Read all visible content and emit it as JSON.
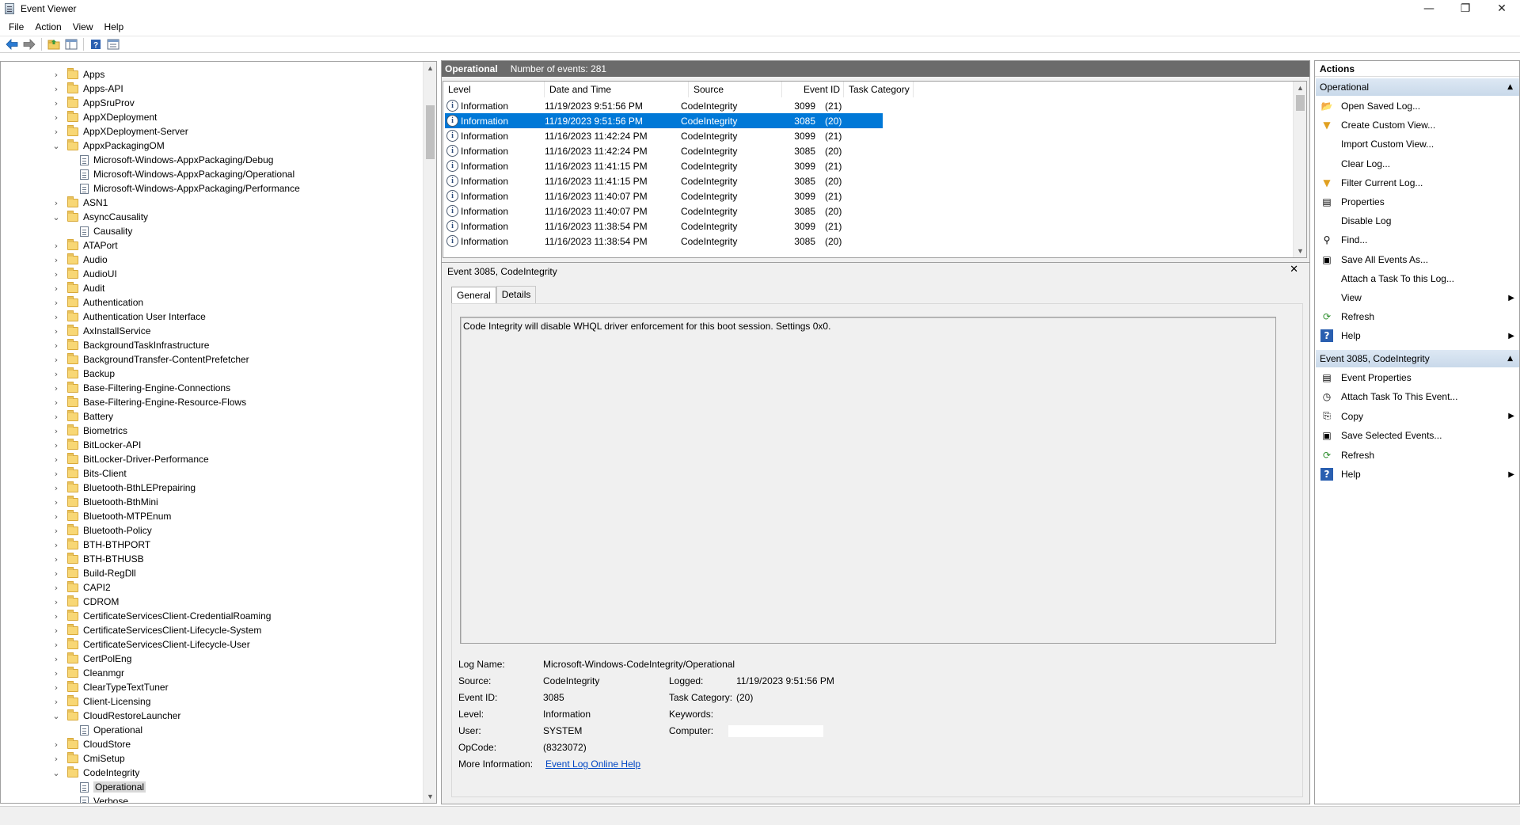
{
  "window": {
    "title": "Event Viewer",
    "controls": {
      "minimize": "—",
      "maximize": "❐",
      "close": "✕"
    }
  },
  "menu": [
    "File",
    "Action",
    "View",
    "Help"
  ],
  "toolbar": {
    "icons": [
      "back-arrow-icon",
      "forward-arrow-icon",
      "open-folder-icon",
      "show-hide-tree-icon",
      "help-icon",
      "properties-icon"
    ]
  },
  "tree": {
    "items": [
      {
        "label": "Apps",
        "level": 1,
        "expander": "›",
        "icon": "folder"
      },
      {
        "label": "Apps-API",
        "level": 1,
        "expander": "›",
        "icon": "folder"
      },
      {
        "label": "AppSruProv",
        "level": 1,
        "expander": "›",
        "icon": "folder"
      },
      {
        "label": "AppXDeployment",
        "level": 1,
        "expander": "›",
        "icon": "folder"
      },
      {
        "label": "AppXDeployment-Server",
        "level": 1,
        "expander": "›",
        "icon": "folder"
      },
      {
        "label": "AppxPackagingOM",
        "level": 1,
        "expander": "⌄",
        "icon": "folder"
      },
      {
        "label": "Microsoft-Windows-AppxPackaging/Debug",
        "level": 2,
        "expander": "",
        "icon": "log"
      },
      {
        "label": "Microsoft-Windows-AppxPackaging/Operational",
        "level": 2,
        "expander": "",
        "icon": "log"
      },
      {
        "label": "Microsoft-Windows-AppxPackaging/Performance",
        "level": 2,
        "expander": "",
        "icon": "log"
      },
      {
        "label": "ASN1",
        "level": 1,
        "expander": "›",
        "icon": "folder"
      },
      {
        "label": "AsyncCausality",
        "level": 1,
        "expander": "⌄",
        "icon": "folder"
      },
      {
        "label": "Causality",
        "level": 2,
        "expander": "",
        "icon": "log"
      },
      {
        "label": "ATAPort",
        "level": 1,
        "expander": "›",
        "icon": "folder"
      },
      {
        "label": "Audio",
        "level": 1,
        "expander": "›",
        "icon": "folder"
      },
      {
        "label": "AudioUI",
        "level": 1,
        "expander": "›",
        "icon": "folder"
      },
      {
        "label": "Audit",
        "level": 1,
        "expander": "›",
        "icon": "folder"
      },
      {
        "label": "Authentication",
        "level": 1,
        "expander": "›",
        "icon": "folder"
      },
      {
        "label": "Authentication User Interface",
        "level": 1,
        "expander": "›",
        "icon": "folder"
      },
      {
        "label": "AxInstallService",
        "level": 1,
        "expander": "›",
        "icon": "folder"
      },
      {
        "label": "BackgroundTaskInfrastructure",
        "level": 1,
        "expander": "›",
        "icon": "folder"
      },
      {
        "label": "BackgroundTransfer-ContentPrefetcher",
        "level": 1,
        "expander": "›",
        "icon": "folder"
      },
      {
        "label": "Backup",
        "level": 1,
        "expander": "›",
        "icon": "folder"
      },
      {
        "label": "Base-Filtering-Engine-Connections",
        "level": 1,
        "expander": "›",
        "icon": "folder"
      },
      {
        "label": "Base-Filtering-Engine-Resource-Flows",
        "level": 1,
        "expander": "›",
        "icon": "folder"
      },
      {
        "label": "Battery",
        "level": 1,
        "expander": "›",
        "icon": "folder"
      },
      {
        "label": "Biometrics",
        "level": 1,
        "expander": "›",
        "icon": "folder"
      },
      {
        "label": "BitLocker-API",
        "level": 1,
        "expander": "›",
        "icon": "folder"
      },
      {
        "label": "BitLocker-Driver-Performance",
        "level": 1,
        "expander": "›",
        "icon": "folder"
      },
      {
        "label": "Bits-Client",
        "level": 1,
        "expander": "›",
        "icon": "folder"
      },
      {
        "label": "Bluetooth-BthLEPrepairing",
        "level": 1,
        "expander": "›",
        "icon": "folder"
      },
      {
        "label": "Bluetooth-BthMini",
        "level": 1,
        "expander": "›",
        "icon": "folder"
      },
      {
        "label": "Bluetooth-MTPEnum",
        "level": 1,
        "expander": "›",
        "icon": "folder"
      },
      {
        "label": "Bluetooth-Policy",
        "level": 1,
        "expander": "›",
        "icon": "folder"
      },
      {
        "label": "BTH-BTHPORT",
        "level": 1,
        "expander": "›",
        "icon": "folder"
      },
      {
        "label": "BTH-BTHUSB",
        "level": 1,
        "expander": "›",
        "icon": "folder"
      },
      {
        "label": "Build-RegDll",
        "level": 1,
        "expander": "›",
        "icon": "folder"
      },
      {
        "label": "CAPI2",
        "level": 1,
        "expander": "›",
        "icon": "folder"
      },
      {
        "label": "CDROM",
        "level": 1,
        "expander": "›",
        "icon": "folder"
      },
      {
        "label": "CertificateServicesClient-CredentialRoaming",
        "level": 1,
        "expander": "›",
        "icon": "folder"
      },
      {
        "label": "CertificateServicesClient-Lifecycle-System",
        "level": 1,
        "expander": "›",
        "icon": "folder"
      },
      {
        "label": "CertificateServicesClient-Lifecycle-User",
        "level": 1,
        "expander": "›",
        "icon": "folder"
      },
      {
        "label": "CertPolEng",
        "level": 1,
        "expander": "›",
        "icon": "folder"
      },
      {
        "label": "Cleanmgr",
        "level": 1,
        "expander": "›",
        "icon": "folder"
      },
      {
        "label": "ClearTypeTextTuner",
        "level": 1,
        "expander": "›",
        "icon": "folder"
      },
      {
        "label": "Client-Licensing",
        "level": 1,
        "expander": "›",
        "icon": "folder"
      },
      {
        "label": "CloudRestoreLauncher",
        "level": 1,
        "expander": "⌄",
        "icon": "folder"
      },
      {
        "label": "Operational",
        "level": 2,
        "expander": "",
        "icon": "log"
      },
      {
        "label": "CloudStore",
        "level": 1,
        "expander": "›",
        "icon": "folder"
      },
      {
        "label": "CmiSetup",
        "level": 1,
        "expander": "›",
        "icon": "folder"
      },
      {
        "label": "CodeIntegrity",
        "level": 1,
        "expander": "⌄",
        "icon": "folder"
      },
      {
        "label": "Operational",
        "level": 2,
        "expander": "",
        "icon": "log",
        "selected": true
      },
      {
        "label": "Verbose",
        "level": 2,
        "expander": "",
        "icon": "log"
      }
    ]
  },
  "center": {
    "log_name": "Operational",
    "event_count": "Number of events: 281",
    "columns": [
      "Level",
      "Date and Time",
      "Source",
      "Event ID",
      "Task Category"
    ],
    "events": [
      {
        "level": "Information",
        "datetime": "11/19/2023 9:51:56 PM",
        "source": "CodeIntegrity",
        "id": "3099",
        "category": "(21)"
      },
      {
        "level": "Information",
        "datetime": "11/19/2023 9:51:56 PM",
        "source": "CodeIntegrity",
        "id": "3085",
        "category": "(20)",
        "selected": true
      },
      {
        "level": "Information",
        "datetime": "11/16/2023 11:42:24 PM",
        "source": "CodeIntegrity",
        "id": "3099",
        "category": "(21)"
      },
      {
        "level": "Information",
        "datetime": "11/16/2023 11:42:24 PM",
        "source": "CodeIntegrity",
        "id": "3085",
        "category": "(20)"
      },
      {
        "level": "Information",
        "datetime": "11/16/2023 11:41:15 PM",
        "source": "CodeIntegrity",
        "id": "3099",
        "category": "(21)"
      },
      {
        "level": "Information",
        "datetime": "11/16/2023 11:41:15 PM",
        "source": "CodeIntegrity",
        "id": "3085",
        "category": "(20)"
      },
      {
        "level": "Information",
        "datetime": "11/16/2023 11:40:07 PM",
        "source": "CodeIntegrity",
        "id": "3099",
        "category": "(21)"
      },
      {
        "level": "Information",
        "datetime": "11/16/2023 11:40:07 PM",
        "source": "CodeIntegrity",
        "id": "3085",
        "category": "(20)"
      },
      {
        "level": "Information",
        "datetime": "11/16/2023 11:38:54 PM",
        "source": "CodeIntegrity",
        "id": "3099",
        "category": "(21)"
      },
      {
        "level": "Information",
        "datetime": "11/16/2023 11:38:54 PM",
        "source": "CodeIntegrity",
        "id": "3085",
        "category": "(20)"
      }
    ],
    "detail": {
      "title": "Event 3085, CodeIntegrity",
      "close": "✕",
      "tabs": [
        "General",
        "Details"
      ],
      "message": "Code Integrity will disable WHQL driver enforcement for this boot session.  Settings 0x0.",
      "fields": {
        "log_name_label": "Log Name:",
        "log_name": "Microsoft-Windows-CodeIntegrity/Operational",
        "source_label": "Source:",
        "source": "CodeIntegrity",
        "logged_label": "Logged:",
        "logged": "11/19/2023 9:51:56 PM",
        "event_id_label": "Event ID:",
        "event_id": "3085",
        "task_label": "Task Category:",
        "task": "(20)",
        "level_label": "Level:",
        "level": "Information",
        "keywords_label": "Keywords:",
        "user_label": "User:",
        "user": "SYSTEM",
        "computer_label": "Computer:",
        "opcode_label": "OpCode:",
        "opcode": "(8323072)",
        "more_label": "More Information:",
        "more_link": "Event Log Online Help"
      }
    }
  },
  "actions": {
    "title": "Actions",
    "sections": [
      {
        "header": "Operational",
        "items": [
          {
            "label": "Open Saved Log...",
            "icon": "open-saved-log-icon",
            "glyph": "📂",
            "submenu": false
          },
          {
            "label": "Create Custom View...",
            "icon": "filter-icon",
            "glyph": "▼",
            "submenu": false
          },
          {
            "label": "Import Custom View...",
            "icon": "",
            "glyph": "",
            "submenu": false
          },
          {
            "label": "Clear Log...",
            "icon": "",
            "glyph": "",
            "submenu": false
          },
          {
            "label": "Filter Current Log...",
            "icon": "filter-icon",
            "glyph": "▼",
            "submenu": false
          },
          {
            "label": "Properties",
            "icon": "properties-icon",
            "glyph": "▤",
            "submenu": false
          },
          {
            "label": "Disable Log",
            "icon": "",
            "glyph": "",
            "submenu": false
          },
          {
            "label": "Find...",
            "icon": "binoculars-icon",
            "glyph": "⚲",
            "submenu": false
          },
          {
            "label": "Save All Events As...",
            "icon": "save-icon",
            "glyph": "▣",
            "submenu": false
          },
          {
            "label": "Attach a Task To this Log...",
            "icon": "",
            "glyph": "",
            "submenu": false
          },
          {
            "label": "View",
            "icon": "",
            "glyph": "",
            "submenu": true
          },
          {
            "label": "Refresh",
            "icon": "refresh-icon",
            "glyph": "⟳",
            "submenu": false
          },
          {
            "label": "Help",
            "icon": "help-icon",
            "glyph": "?",
            "submenu": true
          }
        ]
      },
      {
        "header": "Event 3085, CodeIntegrity",
        "items": [
          {
            "label": "Event Properties",
            "icon": "event-properties-icon",
            "glyph": "▤",
            "submenu": false
          },
          {
            "label": "Attach Task To This Event...",
            "icon": "task-icon",
            "glyph": "◷",
            "submenu": false
          },
          {
            "label": "Copy",
            "icon": "copy-icon",
            "glyph": "⎘",
            "submenu": true
          },
          {
            "label": "Save Selected Events...",
            "icon": "save-icon",
            "glyph": "▣",
            "submenu": false
          },
          {
            "label": "Refresh",
            "icon": "refresh-icon",
            "glyph": "⟳",
            "submenu": false
          },
          {
            "label": "Help",
            "icon": "help-icon",
            "glyph": "?",
            "submenu": true
          }
        ]
      }
    ]
  },
  "colors": {
    "selection": "#0078d7",
    "header_bar": "#6b6b6b",
    "section_header": "#c9d9ea",
    "link": "#0046c3"
  }
}
